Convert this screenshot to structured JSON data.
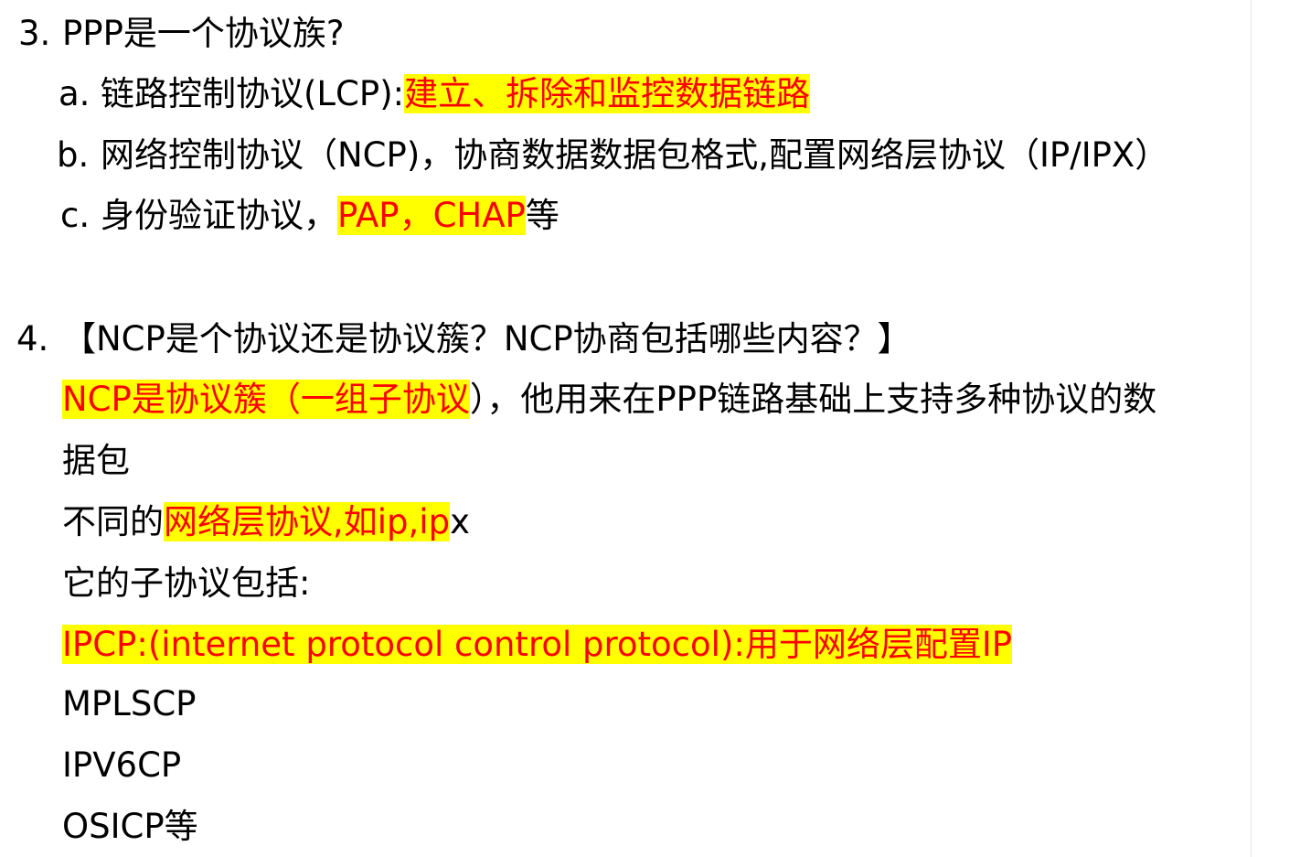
{
  "colors": {
    "highlight_bg": "#ffff00",
    "highlight_text": "#ff0000",
    "body_text": "#000000"
  },
  "q3": {
    "number": "3.",
    "title": "PPP是一个协议族?",
    "items": [
      {
        "marker": "a.",
        "text_before": "链路控制协议(LCP):",
        "highlight": "建立、拆除和监控数据链路",
        "text_after": ""
      },
      {
        "marker": "b.",
        "text_before": "网络控制协议（NCP)，协商数据数据包格式,配置网络层协议（IP/IPX）",
        "highlight": "",
        "text_after": ""
      },
      {
        "marker": "c.",
        "text_before": "身份验证协议，",
        "highlight": "PAP，CHAP",
        "text_after": "等"
      }
    ]
  },
  "q4": {
    "number": "4.",
    "title": "【NCP是个协议还是协议簇？NCP协商包括哪些内容？】",
    "answer_line1": {
      "highlight": "NCP是协议簇（一组子协议",
      "text_after": "），他用来在PPP链路基础上支持多种协议的数"
    },
    "answer_line2": "据包",
    "answer_line3": {
      "text_before": "不同的",
      "highlight": "网络层协议,如ip,ip",
      "text_after": "x"
    },
    "answer_line4": "它的子协议包括:",
    "answer_line5": {
      "highlight": "IPCP:(internet protocol control protocol):用于网络层配置IP"
    },
    "sub_protocols": [
      "MPLSCP",
      "IPV6CP",
      "OSICP等"
    ]
  }
}
